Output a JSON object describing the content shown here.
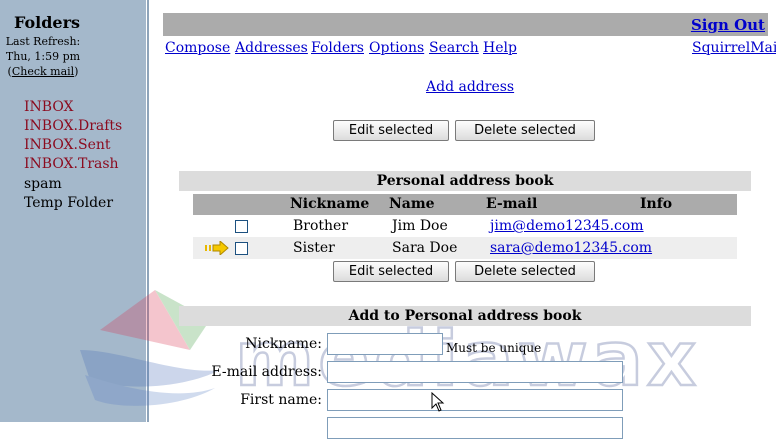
{
  "sidebar": {
    "title": "Folders",
    "last_refresh_label": "Last Refresh:",
    "refresh_time": "Thu, 1:59 pm",
    "check_mail_open": "(",
    "check_mail": "Check mail",
    "check_mail_close": ")",
    "folders": [
      {
        "label": "INBOX",
        "color": "#8b0a1e"
      },
      {
        "label": "INBOX.Drafts",
        "color": "#8b0a1e"
      },
      {
        "label": "INBOX.Sent",
        "color": "#8b0a1e"
      },
      {
        "label": "INBOX.Trash",
        "color": "#8b0a1e"
      },
      {
        "label": "spam",
        "color": "#000000"
      },
      {
        "label": "Temp Folder",
        "color": "#000000"
      }
    ]
  },
  "header": {
    "sign_out": "Sign Out",
    "nav": [
      "Compose",
      "Addresses",
      "Folders",
      "Options",
      "Search",
      "Help"
    ],
    "brand_link": "SquirrelMail"
  },
  "add_address_link": "Add address",
  "buttons": {
    "edit_selected": "Edit selected",
    "delete_selected": "Delete selected"
  },
  "addressbook": {
    "title": "Personal address book",
    "columns": [
      "Nickname",
      "Name",
      "E-mail",
      "Info"
    ],
    "rows": [
      {
        "nickname": "Brother",
        "name": "Jim Doe",
        "email": "jim@demo12345.com",
        "info": ""
      },
      {
        "nickname": "Sister",
        "name": "Sara Doe",
        "email": "sara@demo12345.com",
        "info": ""
      }
    ]
  },
  "add_form": {
    "title": "Add to Personal address book",
    "fields": [
      {
        "label": "Nickname:",
        "value": ""
      },
      {
        "label": "E-mail address:",
        "value": ""
      },
      {
        "label": "First name:",
        "value": ""
      }
    ],
    "nickname_hint": "Must be unique"
  },
  "watermark": {
    "text": "mediawax",
    "icon": "mediawax-logo-icon"
  },
  "colors": {
    "sidebar_bg": "#a4b8cb",
    "folder_special": "#8b0a1e",
    "link": "#0000cc",
    "header_bar": "#ababab",
    "section_head": "#dcdcdc"
  }
}
